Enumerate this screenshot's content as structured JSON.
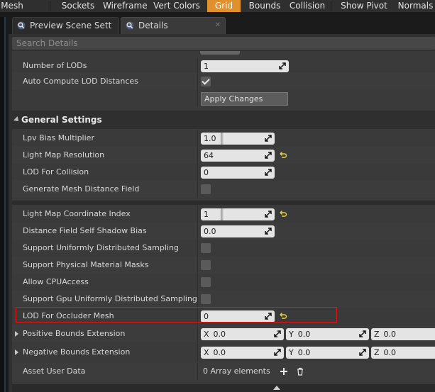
{
  "toolbar": {
    "items": [
      "Mesh",
      "Sockets",
      "Wireframe",
      "Vert Colors",
      "Grid",
      "Bounds",
      "Collision",
      "Show Pivot",
      "Normals"
    ],
    "active": "Grid",
    "active_color": "#e0902d"
  },
  "tabs": [
    {
      "label": "Preview Scene Sett",
      "icon": "magnifier-icon"
    },
    {
      "label": "Details",
      "icon": "magnifier-icon"
    }
  ],
  "search": {
    "placeholder": "Search Details"
  },
  "lod": {
    "number_of_lods_label": "Number of LODs",
    "number_of_lods_value": "1",
    "auto_compute_label": "Auto Compute LOD Distances",
    "auto_compute_checked": true,
    "apply_label": "Apply Changes"
  },
  "general_settings": {
    "title": "General Settings",
    "rows": [
      {
        "label": "Lpv Bias Multiplier",
        "value": "1.0"
      },
      {
        "label": "Light Map Resolution",
        "value": "64"
      },
      {
        "label": "LOD For Collision",
        "value": "0"
      },
      {
        "label": "Generate Mesh Distance Field"
      }
    ]
  },
  "advanced": {
    "rows": [
      {
        "label": "Light Map Coordinate Index",
        "value": "1"
      },
      {
        "label": "Distance Field Self Shadow Bias",
        "value": "0.0"
      },
      {
        "label": "Support Uniformly Distributed Sampling"
      },
      {
        "label": "Support Physical Material Masks"
      },
      {
        "label": "Allow CPUAccess"
      },
      {
        "label": "Support Gpu Uniformly Distributed Sampling"
      },
      {
        "label": "LOD For Occluder Mesh",
        "value": "0"
      }
    ],
    "positive_bounds": {
      "label": "Positive Bounds Extension",
      "x_label": "X",
      "x": "0.0",
      "y_label": "Y",
      "y": "0.0",
      "z_label": "Z",
      "z": "0.0"
    },
    "negative_bounds": {
      "label": "Negative Bounds Extension",
      "x_label": "X",
      "x": "0.0",
      "y_label": "Y",
      "y": "0.0",
      "z_label": "Z",
      "z": "0.0"
    },
    "asset_user_data": {
      "label": "Asset User Data",
      "value": "0 Array elements"
    }
  },
  "colors": {
    "highlight_border": "#e01515",
    "reset_arrow": "#e8d43a"
  }
}
